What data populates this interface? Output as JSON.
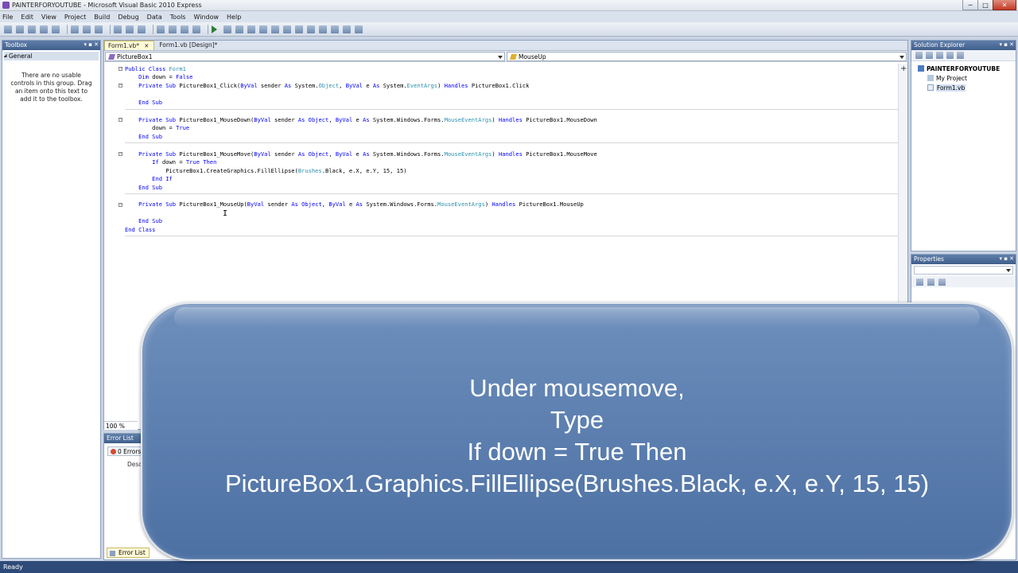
{
  "window": {
    "title": "PAINTERFORYOUTUBE - Microsoft Visual Basic 2010 Express",
    "minimize": "─",
    "maximize": "□",
    "close": "✕"
  },
  "menu": [
    "File",
    "Edit",
    "View",
    "Project",
    "Build",
    "Debug",
    "Data",
    "Tools",
    "Window",
    "Help"
  ],
  "toolbox": {
    "title": "Toolbox",
    "group": "General",
    "empty_message": "There are no usable controls in this group. Drag an item onto this text to add it to the toolbox."
  },
  "editor": {
    "tabs": [
      {
        "label": "Form1.vb*",
        "close": "✕"
      },
      {
        "label": "Form1.vb [Design]*"
      }
    ],
    "object_combo": "PictureBox1",
    "event_combo": "MouseUp",
    "zoom": "100 %",
    "code": {
      "l1_kw": "Public Class",
      "l1_ty": "Form1",
      "l2_kw1": "Dim",
      "l2_txt": "down = ",
      "l2_kw2": "False",
      "l3_kw": "Private Sub",
      "l3_a": "PictureBox1_Click(",
      "l3_kw2": "ByVal",
      "l3_b": "sender",
      "l3_kw3": "As",
      "l3_c": "System.",
      "l3_ty1": "Object",
      "l3_d": ",",
      "l3_kw4": "ByVal",
      "l3_e": "e",
      "l3_kw5": "As",
      "l3_f": "System.",
      "l3_ty2": "EventArgs",
      "l3_g": ")",
      "l3_kw6": "Handles",
      "l3_h": "PictureBox1.Click",
      "end_sub": "End Sub",
      "l5_kw": "Private Sub",
      "l5_a": "PictureBox1_MouseDown(",
      "l5_kw2": "ByVal",
      "l5_b": "sender",
      "l5_kw3": "As Object",
      "l5_c": ",",
      "l5_kw4": "ByVal",
      "l5_d": "e",
      "l5_kw5": "As",
      "l5_e": "System.Windows.Forms.",
      "l5_ty": "MouseEventArgs",
      "l5_f": ")",
      "l5_kw6": "Handles",
      "l5_g": "PictureBox1.MouseDown",
      "l6_txt": "down = ",
      "l6_kw": "True",
      "l8_kw": "Private Sub",
      "l8_a": "PictureBox1_MouseMove(",
      "l8_kw2": "ByVal",
      "l8_b": "sender",
      "l8_kw3": "As Object",
      "l8_c": ",",
      "l8_kw4": "ByVal",
      "l8_d": "e",
      "l8_kw5": "As",
      "l8_e": "System.Windows.Forms.",
      "l8_ty": "MouseEventArgs",
      "l8_f": ")",
      "l8_kw6": "Handles",
      "l8_g": "PictureBox1.MouseMove",
      "l9_kw1": "If",
      "l9_txt": "down = ",
      "l9_kw2": "True Then",
      "l10_a": "PictureBox1.CreateGraphics.FillEllipse(",
      "l10_ty": "Brushes",
      "l10_b": ".Black, e.X, e.Y, 15, 15)",
      "l11_kw": "End If",
      "l13_kw": "Private Sub",
      "l13_a": "PictureBox1_MouseUp(",
      "l13_kw2": "ByVal",
      "l13_b": "sender",
      "l13_kw3": "As Object",
      "l13_c": ",",
      "l13_kw4": "ByVal",
      "l13_d": "e",
      "l13_kw5": "As",
      "l13_e": "System.Windows.Forms.",
      "l13_ty": "MouseEventArgs",
      "l13_f": ")",
      "l13_kw6": "Handles",
      "l13_g": "PictureBox1.MouseUp",
      "end_class": "End Class"
    }
  },
  "error_list": {
    "title": "Error List",
    "errors_button": "0 Errors",
    "column": "Desc",
    "bottom_tab": "Error List"
  },
  "solution_explorer": {
    "title": "Solution Explorer",
    "project": "PAINTERFORYOUTUBE",
    "items": [
      "My Project",
      "Form1.vb"
    ]
  },
  "properties": {
    "title": "Properties"
  },
  "status": "Ready",
  "caption": {
    "line1": "Under mousemove,",
    "line2": "Type",
    "line3": "If down = True Then",
    "line4": "PictureBox1.Graphics.FillEllipse(Brushes.Black, e.X, e.Y, 15, 15)"
  }
}
